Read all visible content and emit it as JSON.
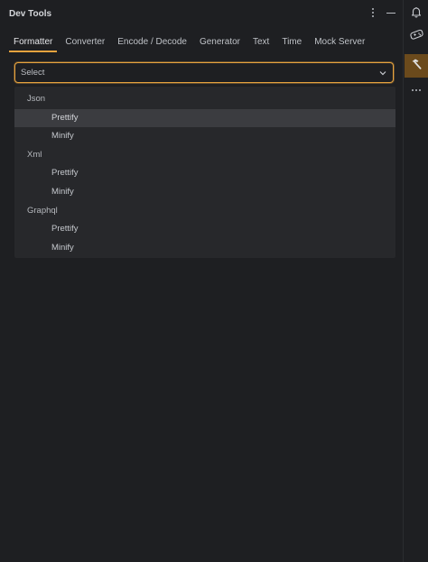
{
  "panel": {
    "title": "Dev Tools"
  },
  "tabs": [
    {
      "label": "Formatter",
      "active": true
    },
    {
      "label": "Converter",
      "active": false
    },
    {
      "label": "Encode / Decode",
      "active": false
    },
    {
      "label": "Generator",
      "active": false
    },
    {
      "label": "Text",
      "active": false
    },
    {
      "label": "Time",
      "active": false
    },
    {
      "label": "Mock Server",
      "active": false
    }
  ],
  "select": {
    "value": "Select"
  },
  "dropdown": {
    "groups": [
      {
        "label": "Json",
        "options": [
          "Prettify",
          "Minify"
        ]
      },
      {
        "label": "Xml",
        "options": [
          "Prettify",
          "Minify"
        ]
      },
      {
        "label": "Graphql",
        "options": [
          "Prettify",
          "Minify"
        ]
      }
    ],
    "highlighted": "Json > Prettify"
  },
  "strip": {
    "buttons": [
      "bell-icon",
      "game-controller-icon",
      "hammer-icon",
      "more-horizontal-icon"
    ],
    "active": "hammer-icon"
  },
  "colors": {
    "accent": "#e7a33e",
    "background": "#1e1f22",
    "dropdown_bg": "#27282b",
    "highlight_bg": "#3b3c40",
    "active_strip_bg": "#6b4a1c"
  }
}
